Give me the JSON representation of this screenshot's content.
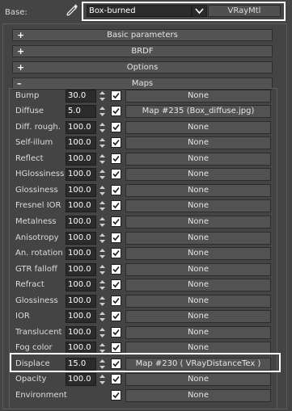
{
  "header": {
    "base_label": "Base:",
    "material_name": "Box-burned",
    "material_type": "VRayMtl"
  },
  "rollouts": [
    {
      "sign": "+",
      "title": "Basic parameters"
    },
    {
      "sign": "+",
      "title": "BRDF"
    },
    {
      "sign": "+",
      "title": "Options"
    },
    {
      "sign": "–",
      "title": "Maps"
    }
  ],
  "maps": [
    {
      "label": "Bump",
      "value": "30.0",
      "map": "None"
    },
    {
      "label": "Diffuse",
      "value": "5.0",
      "map": "Map #235 (Box_diffuse.jpg)"
    },
    {
      "label": "Diff. rough.",
      "value": "100.0",
      "map": "None"
    },
    {
      "label": "Self-illum",
      "value": "100.0",
      "map": "None"
    },
    {
      "label": "Reflect",
      "value": "100.0",
      "map": "None"
    },
    {
      "label": "HGlossiness",
      "value": "100.0",
      "map": "None"
    },
    {
      "label": "Glossiness",
      "value": "100.0",
      "map": "None"
    },
    {
      "label": "Fresnel IOR",
      "value": "100.0",
      "map": "None"
    },
    {
      "label": "Metalness",
      "value": "100.0",
      "map": "None"
    },
    {
      "label": "Anisotropy",
      "value": "100.0",
      "map": "None"
    },
    {
      "label": "An. rotation",
      "value": "100.0",
      "map": "None"
    },
    {
      "label": "GTR falloff",
      "value": "100.0",
      "map": "None"
    },
    {
      "label": "Refract",
      "value": "100.0",
      "map": "None"
    },
    {
      "label": "Glossiness",
      "value": "100.0",
      "map": "None"
    },
    {
      "label": "IOR",
      "value": "100.0",
      "map": "None"
    },
    {
      "label": "Translucent",
      "value": "100.0",
      "map": "None"
    },
    {
      "label": "Fog color",
      "value": "100.0",
      "map": "None"
    },
    {
      "label": "Displace",
      "value": "15.0",
      "map": "Map #230  ( VRayDistanceTex )"
    },
    {
      "label": "Opacity",
      "value": "100.0",
      "map": "None"
    },
    {
      "label": "Environment",
      "map": "None"
    }
  ],
  "colors": {
    "background": "#444444",
    "field": "#2b2b2b",
    "button": "#525252",
    "highlight_border": "#ffffff"
  },
  "icons": {
    "picker": "eyedropper-icon",
    "dropdown": "chevron-down-icon",
    "spinner": "spinner-arrows-icon",
    "checkbox": "checkmark-icon"
  }
}
